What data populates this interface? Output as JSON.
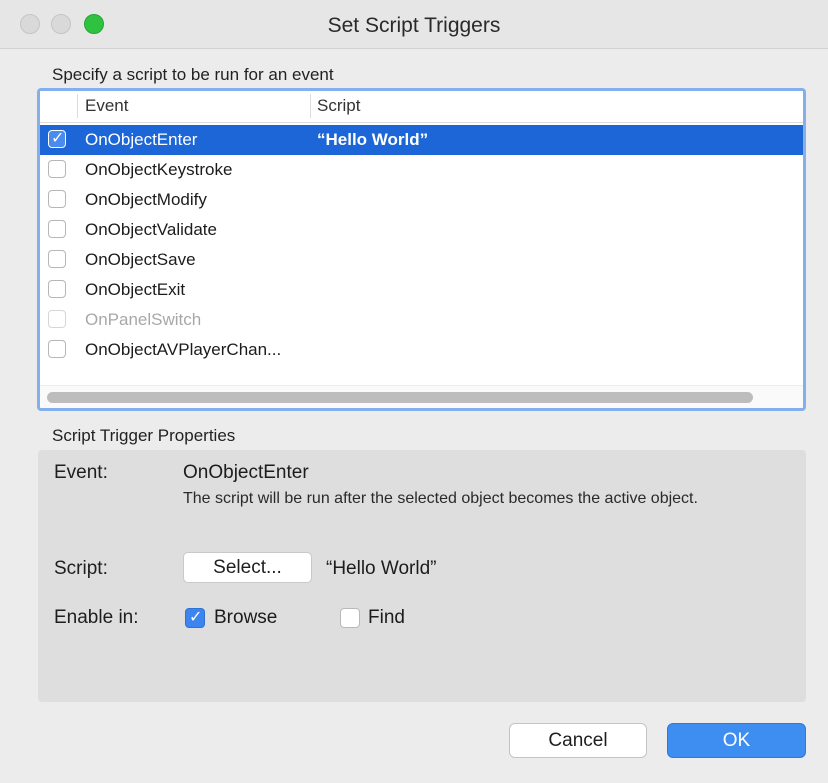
{
  "window": {
    "title": "Set Script Triggers"
  },
  "events_list": {
    "heading": "Specify a script to be run for an event",
    "columns": {
      "event": "Event",
      "script": "Script"
    },
    "rows": [
      {
        "event": "OnObjectEnter",
        "script": "“Hello World”",
        "checked": true,
        "selected": true,
        "disabled": false
      },
      {
        "event": "OnObjectKeystroke",
        "script": "",
        "checked": false,
        "selected": false,
        "disabled": false
      },
      {
        "event": "OnObjectModify",
        "script": "",
        "checked": false,
        "selected": false,
        "disabled": false
      },
      {
        "event": "OnObjectValidate",
        "script": "",
        "checked": false,
        "selected": false,
        "disabled": false
      },
      {
        "event": "OnObjectSave",
        "script": "",
        "checked": false,
        "selected": false,
        "disabled": false
      },
      {
        "event": "OnObjectExit",
        "script": "",
        "checked": false,
        "selected": false,
        "disabled": false
      },
      {
        "event": "OnPanelSwitch",
        "script": "",
        "checked": false,
        "selected": false,
        "disabled": true
      },
      {
        "event": "OnObjectAVPlayerChan...",
        "script": "",
        "checked": false,
        "selected": false,
        "disabled": false
      }
    ]
  },
  "properties": {
    "heading": "Script Trigger Properties",
    "event_label": "Event:",
    "event_name": "OnObjectEnter",
    "event_description": "The script will be run after the selected object becomes the active object.",
    "script_label": "Script:",
    "select_button": "Select...",
    "script_name": "“Hello World”",
    "enable_label": "Enable in:",
    "browse": {
      "label": "Browse",
      "checked": true
    },
    "find": {
      "label": "Find",
      "checked": false
    }
  },
  "buttons": {
    "cancel": "Cancel",
    "ok": "OK"
  },
  "colors": {
    "selection": "#1c66d8",
    "accent": "#3e8ef2",
    "focus_ring": "#83b0ec"
  }
}
